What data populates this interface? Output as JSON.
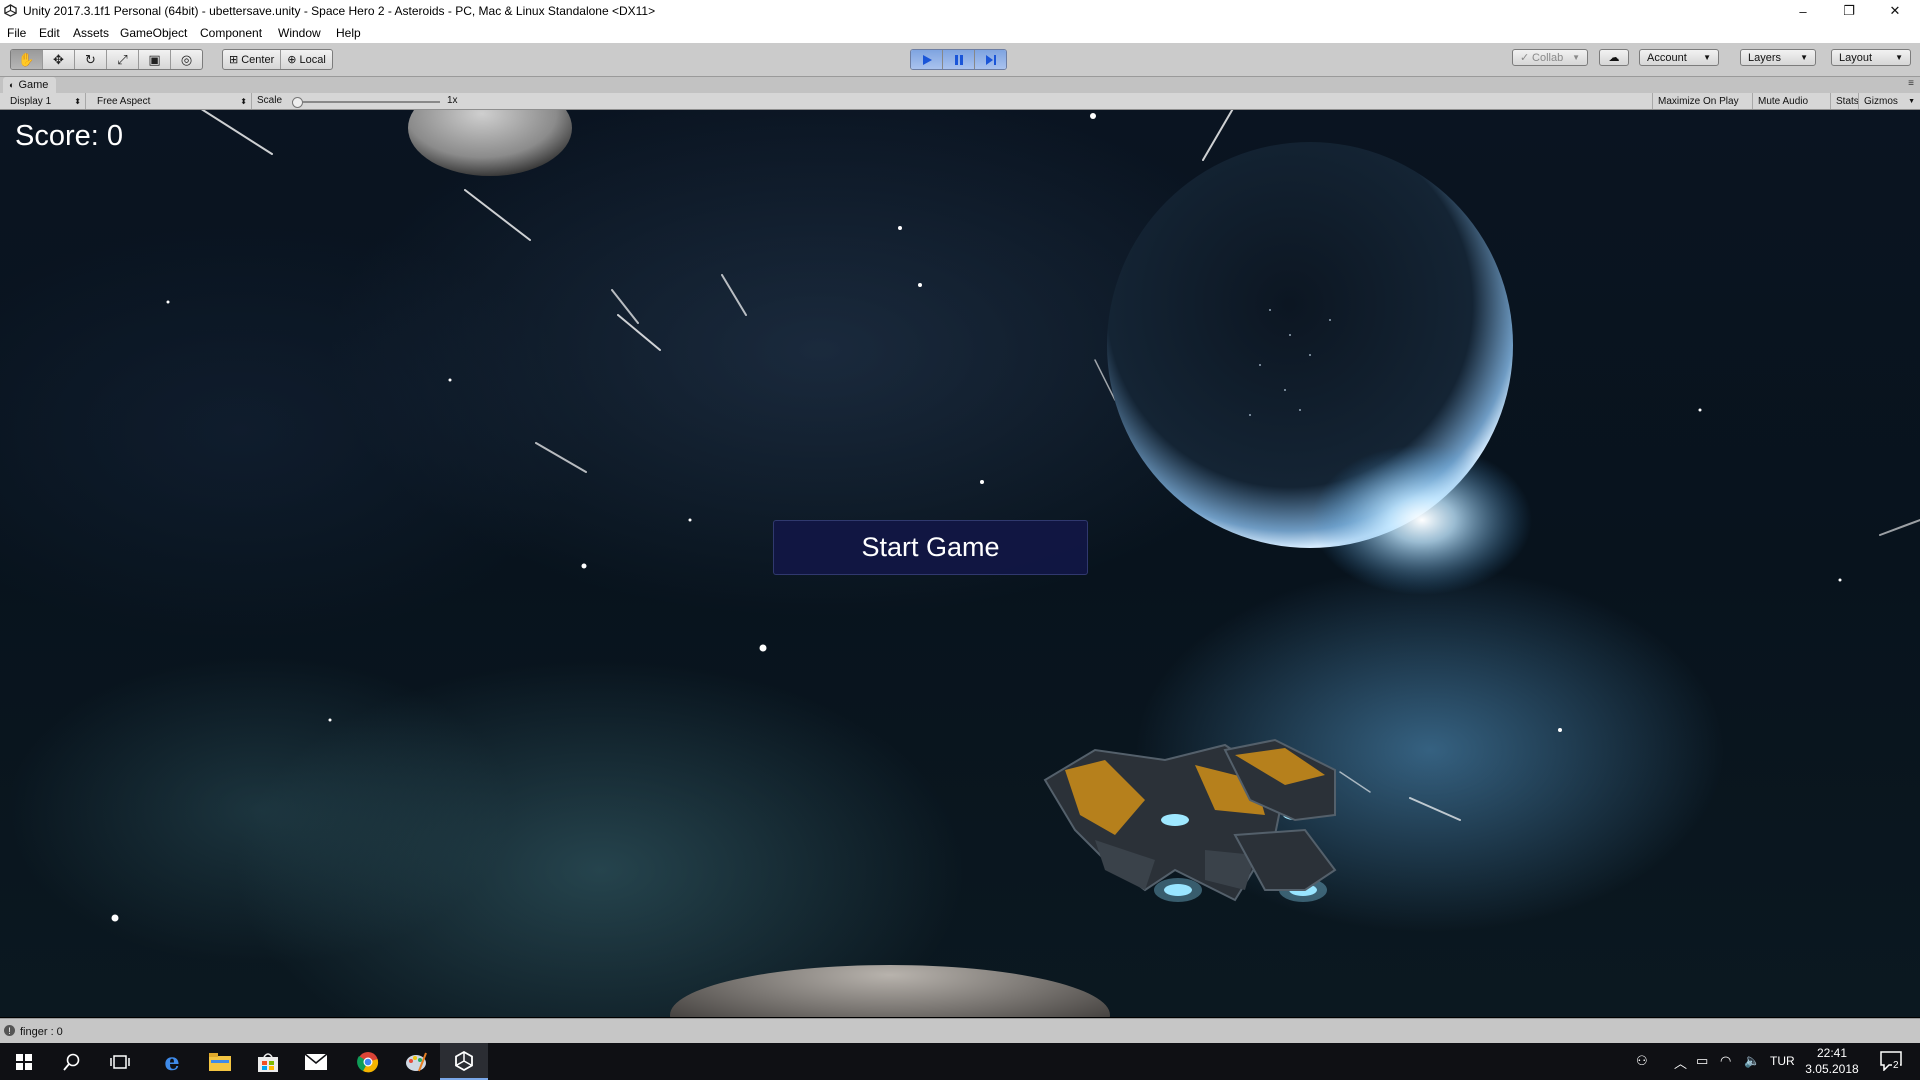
{
  "window": {
    "title": "Unity 2017.3.1f1 Personal (64bit) - ubettersave.unity - Space Hero 2 - Asteroids - PC, Mac & Linux Standalone <DX11>",
    "controls": [
      "–",
      "❐",
      "✕"
    ]
  },
  "menu": [
    "File",
    "Edit",
    "Assets",
    "GameObject",
    "Component",
    "Window",
    "Help"
  ],
  "toolbar": {
    "tools": [
      "hand-tool-icon",
      "move-tool-icon",
      "rotate-tool-icon",
      "scale-tool-icon",
      "rect-tool-icon",
      "transform-tool-icon"
    ],
    "active_tool": "hand",
    "pivot_mode": "Center",
    "pivot_rotation": "Local",
    "play_state": "playing",
    "collab": "Collab",
    "account": "Account",
    "layers": "Layers",
    "layout": "Layout"
  },
  "game_panel": {
    "tab": "Game",
    "display": "Display 1",
    "aspect": "Free Aspect",
    "scale_label": "Scale",
    "scale_value": "1x",
    "scale_fraction": 0.0,
    "toggles": [
      "Maximize On Play",
      "Mute Audio",
      "Stats",
      "Gizmos"
    ]
  },
  "game": {
    "score_text": "Score: 0",
    "start_button": "Start Game"
  },
  "status": {
    "message": "finger : 0"
  },
  "taskbar": {
    "apps": [
      "windows-start-icon",
      "search-icon",
      "task-view-icon",
      "edge-icon",
      "file-explorer-icon",
      "store-icon",
      "mail-icon",
      "chrome-icon",
      "paint-icon",
      "unity-icon"
    ],
    "active_app": "unity-icon",
    "language": "TUR",
    "time": "22:41",
    "date": "3.05.2018",
    "notification_count": "2"
  }
}
